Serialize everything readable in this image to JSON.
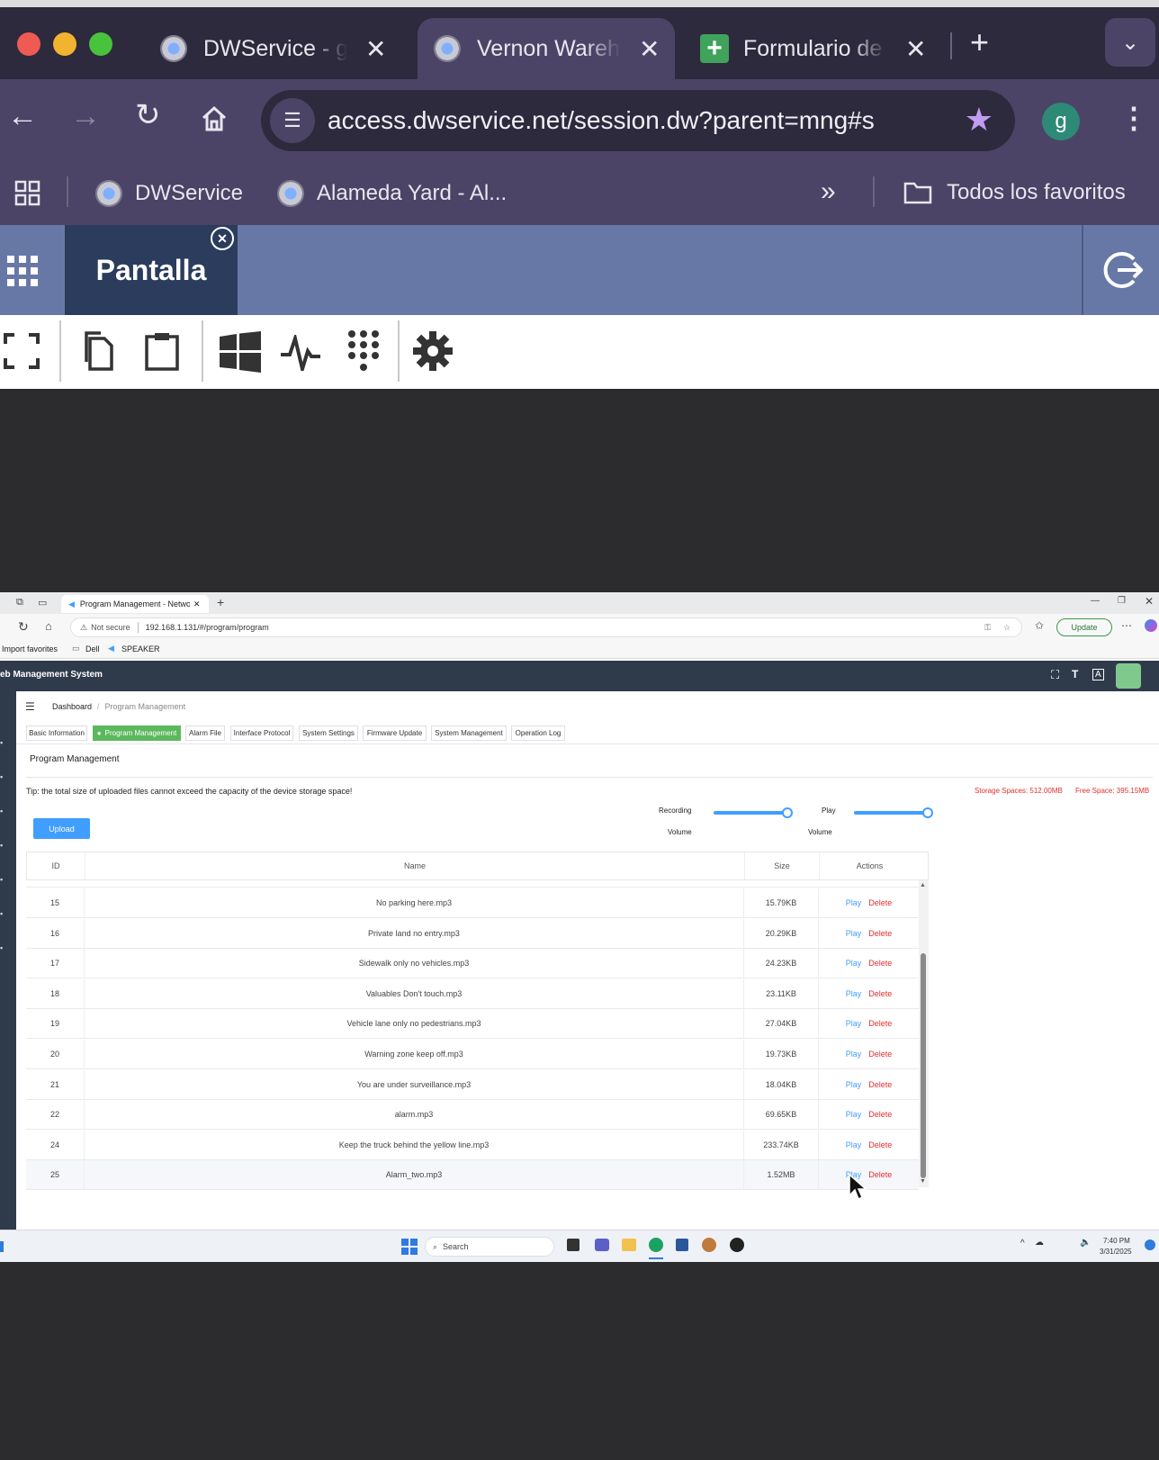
{
  "mac": {
    "tabs": [
      {
        "title": "DWService - g"
      },
      {
        "title": "Vernon Wareh"
      },
      {
        "title": "Formulario de"
      }
    ],
    "url": "access.dwservice.net/session.dw?parent=mng#s",
    "profile": "g",
    "bookmarks": [
      "DWService",
      "Alameda Yard - Al..."
    ],
    "all_favorites": "Todos los favoritos",
    "more": "»"
  },
  "dw": {
    "tab_label": "Pantalla"
  },
  "remote": {
    "tab_title": "Program Management - Network",
    "security": "Not secure",
    "address": "192.168.1.131/#/program/program",
    "update_label": "Update",
    "favs": [
      "Import favorites",
      "Dell",
      "SPEAKER"
    ],
    "app_title": "eb Management System",
    "breadcrumb": {
      "root": "Dashboard",
      "sep": "/",
      "current": "Program Management"
    },
    "tabs": [
      "Basic Information",
      "Program Management",
      "Alarm File",
      "Interface Protocol",
      "System Settings",
      "Firmware Update",
      "System Management",
      "Operation Log"
    ],
    "section_title": "Program Management",
    "tip": "Tip: the total size of uploaded files cannot exceed the capacity of the device storage space!",
    "storage": "Storage Spaces: 512.00MB",
    "free": "Free Space: 395.15MB",
    "upload_label": "Upload",
    "recording_volume": {
      "line1": "Recording",
      "line2": "Volume",
      "level": 1.0
    },
    "play_volume": {
      "line1": "Play",
      "line2": "Volume",
      "level": 1.0
    },
    "columns": {
      "id": "ID",
      "name": "Name",
      "size": "Size",
      "actions": "Actions"
    },
    "play_label": "Play",
    "delete_label": "Delete",
    "rows": [
      {
        "id": "15",
        "name": "No parking here.mp3",
        "size": "15.79KB"
      },
      {
        "id": "16",
        "name": "Private land no entry.mp3",
        "size": "20.29KB"
      },
      {
        "id": "17",
        "name": "Sidewalk only no vehicles.mp3",
        "size": "24.23KB"
      },
      {
        "id": "18",
        "name": "Valuables Don't touch.mp3",
        "size": "23.11KB"
      },
      {
        "id": "19",
        "name": "Vehicle lane only no pedestrians.mp3",
        "size": "27.04KB"
      },
      {
        "id": "20",
        "name": "Warning zone keep off.mp3",
        "size": "19.73KB"
      },
      {
        "id": "21",
        "name": "You are under surveillance.mp3",
        "size": "18.04KB"
      },
      {
        "id": "22",
        "name": "alarm.mp3",
        "size": "69.65KB"
      },
      {
        "id": "24",
        "name": "Keep the truck behind the yellow line.mp3",
        "size": "233.74KB"
      },
      {
        "id": "25",
        "name": "Alarm_two.mp3",
        "size": "1.52MB"
      }
    ],
    "taskbar": {
      "search": "Search",
      "time": "7:40 PM",
      "date": "3/31/2025"
    }
  }
}
